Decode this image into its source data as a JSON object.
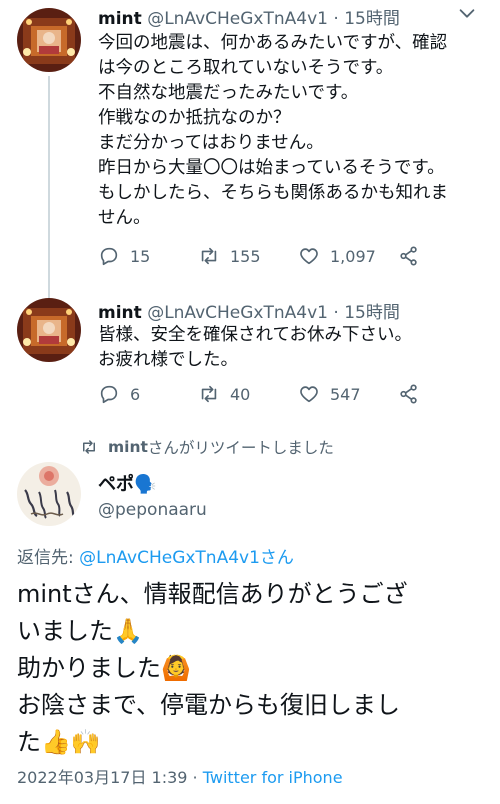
{
  "tweets": [
    {
      "name": "mint",
      "handle": "@LnAvCHeGxTnA4v1",
      "time": "15時間",
      "text": "今回の地震は、何かあるみたいですが、確認\nは今のところ取れていないそうです。\n不自然な地震だったみたいです。\n作戦なのか抵抗なのか？\nまだ分かってはおりません。\n昨日から大量〇〇は始まっているそうです。\nもしかしたら、そちらも関係あるかも知れま\nせん。",
      "replies": "15",
      "retweets": "155",
      "likes": "1,097"
    },
    {
      "name": "mint",
      "handle": "@LnAvCHeGxTnA4v1",
      "time": "15時間",
      "text": "皆様、安全を確保されてお休み下さい。\nお疲れ様でした。",
      "replies": "6",
      "retweets": "40",
      "likes": "547"
    }
  ],
  "separator": "·",
  "retweet_banner": {
    "user": "mint",
    "text": "さんがリツイートしました"
  },
  "main_tweet": {
    "name": "ペポ",
    "name_emoji": "🗣️",
    "handle": "@peponaaru",
    "reply_label": "返信先: ",
    "reply_target": "@LnAvCHeGxTnA4v1さん",
    "text": "mintさん、情報配信ありがとうござ\nいました🙏\n助かりました🙆\nお陰さまで、停電からも復旧しまし\nた👍🙌",
    "timestamp": "2022年03月17日 1:39",
    "meta_sep": " · ",
    "source": "Twitter for iPhone"
  },
  "icons": [
    "reply-icon",
    "retweet-icon",
    "like-icon",
    "share-icon",
    "chevron-down-icon"
  ],
  "colors": {
    "text": "#0f1419",
    "secondary": "#536471",
    "link": "#1d9bf0",
    "thread_line": "#cfd9de"
  }
}
